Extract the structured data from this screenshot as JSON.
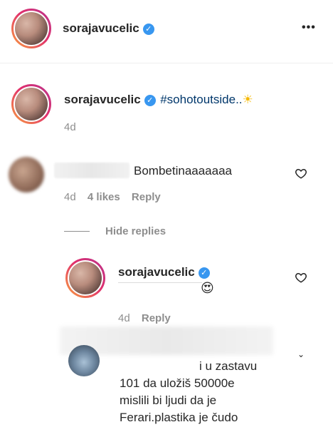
{
  "post_header": {
    "username": "sorajavucelic",
    "more_label": "•••"
  },
  "caption": {
    "username": "sorajavucelic",
    "hashtag": "#sohotoutside..",
    "emoji": "☀",
    "time": "4d"
  },
  "comment1": {
    "text": "Bombetinaaaaaaa",
    "time": "4d",
    "likes": "4 likes",
    "reply_label": "Reply",
    "hide_replies_label": "Hide replies"
  },
  "reply1": {
    "username": "sorajavucelic",
    "emoji": "😍",
    "time": "4d",
    "reply_label": "Reply"
  },
  "comment2": {
    "line1": "i u zastavu",
    "line2": "101 da uložiš 50000e",
    "line3": "mislili bi ljudi da je",
    "line4": "Ferari.plastika je čudo"
  },
  "colors": {
    "accent": "#3897f0",
    "hashtag": "#00376b",
    "muted": "#8e8e8e"
  }
}
